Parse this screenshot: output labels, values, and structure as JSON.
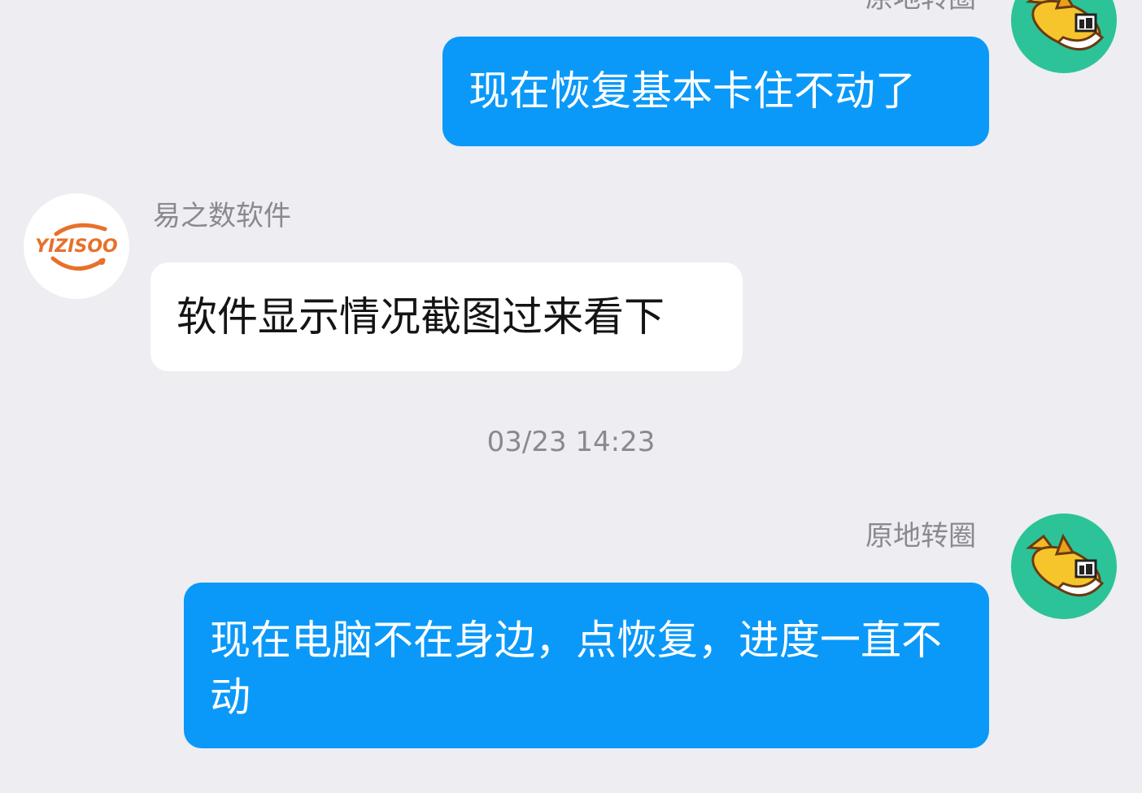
{
  "conversation": {
    "messages": [
      {
        "direction": "outgoing",
        "sender": "原地转圈",
        "text": "现在恢复基本卡住不动了",
        "avatar_icon": "cartoon-fish-avatar"
      },
      {
        "direction": "incoming",
        "sender": "易之数软件",
        "text": "软件显示情况截图过来看下",
        "avatar_icon": "yizishu-logo-avatar",
        "avatar_logo_text": "YIZISOO"
      },
      {
        "direction": "outgoing",
        "sender": "原地转圈",
        "text": "现在电脑不在身边，点恢复，进度一直不动",
        "avatar_icon": "cartoon-fish-avatar"
      }
    ],
    "timestamp": "03/23 14:23"
  },
  "colors": {
    "background": "#ededf2",
    "outgoing_bubble": "#0a99f9",
    "incoming_bubble": "#ffffff",
    "avatar_fish_bg": "#2cc399",
    "brand_orange": "#e8702a"
  }
}
